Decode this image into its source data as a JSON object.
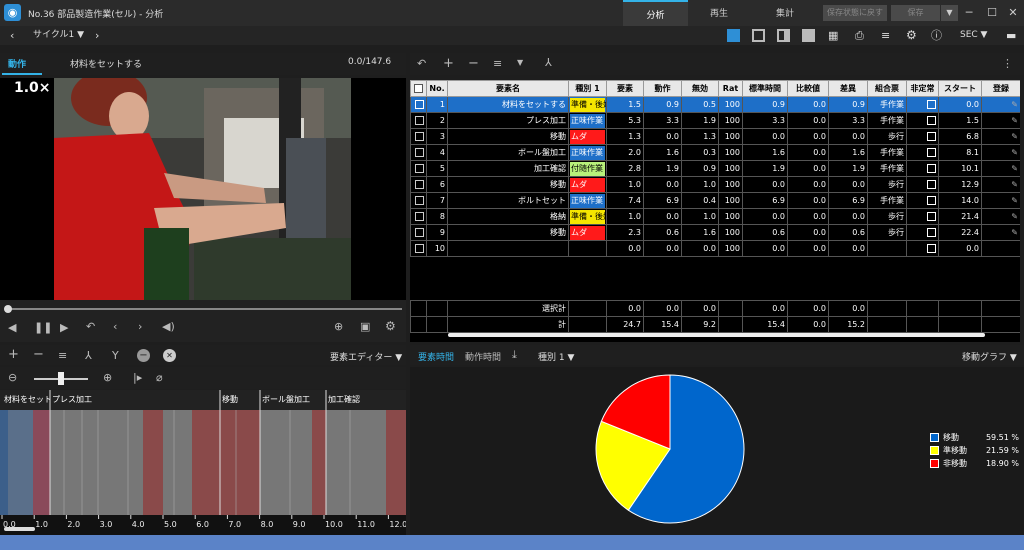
{
  "app": {
    "title": "No.36 部品製造作業(セル) - 分析"
  },
  "nav": {
    "tabs": [
      "分析",
      "再生",
      "集計"
    ],
    "active": 0
  },
  "top_buttons": {
    "save_state": "保存状態に戻す",
    "save": "保存"
  },
  "toolbar": {
    "cycle": "サイクル1",
    "unit": "SEC"
  },
  "video_panel": {
    "tab": "動作",
    "element": "材料をセットする",
    "time": "0.0/147.6",
    "speed": "1.0×"
  },
  "table": {
    "headers": [
      "No.",
      "要素名",
      "種別 1",
      "要素",
      "動作",
      "無効",
      "Rat",
      "標準時間",
      "比較値",
      "差異",
      "組合票",
      "非定常",
      "スタート",
      "登録"
    ],
    "rows": [
      {
        "no": "1",
        "name": "材料をセットする",
        "type": "準備・後始",
        "type_class": "prep",
        "elem": "1.5",
        "motion": "0.9",
        "invalid": "0.5",
        "rat": "100",
        "std": "0.9",
        "cmp": "0.0",
        "diff": "0.9",
        "combo": "手作業",
        "start": "0.0",
        "sel": true
      },
      {
        "no": "2",
        "name": "プレス加工",
        "type": "正味作業",
        "type_class": "main",
        "elem": "5.3",
        "motion": "3.3",
        "invalid": "1.9",
        "rat": "100",
        "std": "3.3",
        "cmp": "0.0",
        "diff": "3.3",
        "combo": "手作業",
        "start": "1.5"
      },
      {
        "no": "3",
        "name": "移動",
        "type": "ムダ",
        "type_class": "waste",
        "elem": "1.3",
        "motion": "0.0",
        "invalid": "1.3",
        "rat": "100",
        "std": "0.0",
        "cmp": "0.0",
        "diff": "0.0",
        "combo": "歩行",
        "start": "6.8"
      },
      {
        "no": "4",
        "name": "ボール盤加工",
        "type": "正味作業",
        "type_class": "main",
        "elem": "2.0",
        "motion": "1.6",
        "invalid": "0.3",
        "rat": "100",
        "std": "1.6",
        "cmp": "0.0",
        "diff": "1.6",
        "combo": "手作業",
        "start": "8.1"
      },
      {
        "no": "5",
        "name": "加工確認",
        "type": "付随作業",
        "type_class": "incid",
        "elem": "2.8",
        "motion": "1.9",
        "invalid": "0.9",
        "rat": "100",
        "std": "1.9",
        "cmp": "0.0",
        "diff": "1.9",
        "combo": "手作業",
        "start": "10.1"
      },
      {
        "no": "6",
        "name": "移動",
        "type": "ムダ",
        "type_class": "waste",
        "elem": "1.0",
        "motion": "0.0",
        "invalid": "1.0",
        "rat": "100",
        "std": "0.0",
        "cmp": "0.0",
        "diff": "0.0",
        "combo": "歩行",
        "start": "12.9"
      },
      {
        "no": "7",
        "name": "ボルトセット",
        "type": "正味作業",
        "type_class": "main",
        "elem": "7.4",
        "motion": "6.9",
        "invalid": "0.4",
        "rat": "100",
        "std": "6.9",
        "cmp": "0.0",
        "diff": "6.9",
        "combo": "手作業",
        "start": "14.0"
      },
      {
        "no": "8",
        "name": "格納",
        "type": "準備・後始",
        "type_class": "prep",
        "elem": "1.0",
        "motion": "0.0",
        "invalid": "1.0",
        "rat": "100",
        "std": "0.0",
        "cmp": "0.0",
        "diff": "0.0",
        "combo": "歩行",
        "start": "21.4"
      },
      {
        "no": "9",
        "name": "移動",
        "type": "ムダ",
        "type_class": "waste",
        "elem": "2.3",
        "motion": "0.6",
        "invalid": "1.6",
        "rat": "100",
        "std": "0.6",
        "cmp": "0.0",
        "diff": "0.6",
        "combo": "歩行",
        "start": "22.4"
      },
      {
        "no": "10",
        "name": "",
        "type": "",
        "type_class": "",
        "elem": "0.0",
        "motion": "0.0",
        "invalid": "0.0",
        "rat": "100",
        "std": "0.0",
        "cmp": "0.0",
        "diff": "0.0",
        "combo": "",
        "start": "0.0"
      }
    ],
    "selected_total": {
      "label": "選択計",
      "elem": "0.0",
      "motion": "0.0",
      "invalid": "0.0",
      "std": "0.0",
      "cmp": "0.0",
      "diff": "0.0"
    },
    "total": {
      "label": "計",
      "elem": "24.7",
      "motion": "15.4",
      "invalid": "9.2",
      "std": "15.4",
      "cmp": "0.0",
      "diff": "15.2"
    }
  },
  "editor": {
    "dropdown": "要素エディター"
  },
  "timeline": {
    "labels": [
      "材料をセット",
      "プレス加工",
      "移動",
      "ボール盤加工",
      "加工確認"
    ],
    "ticks": [
      "0.0",
      "1.0",
      "2.0",
      "3.0",
      "4.0",
      "5.0",
      "6.0",
      "7.0",
      "8.0",
      "9.0",
      "10.0",
      "11.0",
      "12.0"
    ]
  },
  "chart_panel": {
    "tabs": [
      "要素時間",
      "動作時間"
    ],
    "type_dropdown": "種別 1",
    "graph_dropdown": "移動グラフ"
  },
  "chart_data": {
    "type": "pie",
    "labels": [
      "移動",
      "準移動",
      "非移動"
    ],
    "values": [
      59.51,
      21.59,
      18.9
    ],
    "value_labels": [
      "59.51 %",
      "21.59 %",
      "18.90 %"
    ],
    "colors": [
      "#0066cc",
      "#ffff00",
      "#ff0000"
    ],
    "legend_position": "right"
  }
}
